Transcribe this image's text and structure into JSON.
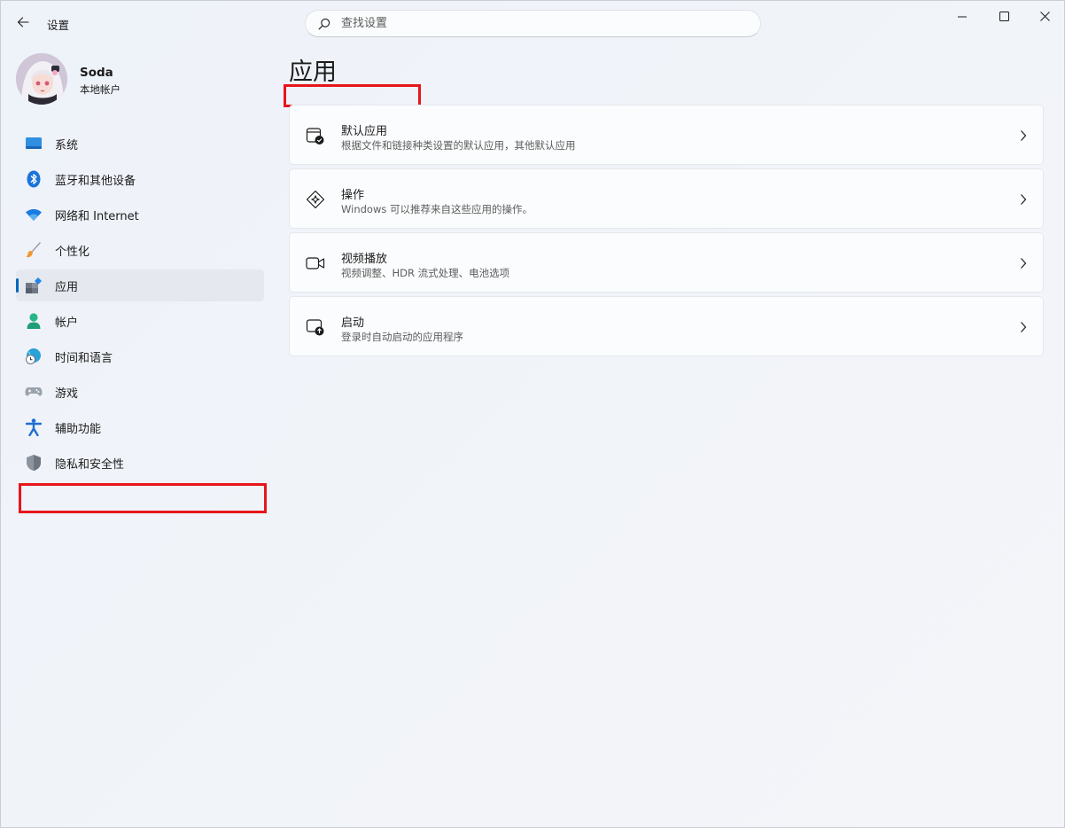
{
  "window": {
    "title": "设置",
    "controls": {
      "minimize": "minimize-icon",
      "maximize": "maximize-icon",
      "close": "close-icon"
    }
  },
  "search": {
    "placeholder": "查找设置",
    "value": ""
  },
  "user": {
    "name": "Soda",
    "account_type": "本地帐户"
  },
  "sidebar": {
    "items": [
      {
        "label": "系统",
        "icon": "monitor-icon",
        "selected": false
      },
      {
        "label": "蓝牙和其他设备",
        "icon": "bluetooth-icon",
        "selected": false
      },
      {
        "label": "网络和 Internet",
        "icon": "wifi-icon",
        "selected": false
      },
      {
        "label": "个性化",
        "icon": "brush-icon",
        "selected": false
      },
      {
        "label": "应用",
        "icon": "apps-icon",
        "selected": true
      },
      {
        "label": "帐户",
        "icon": "person-icon",
        "selected": false
      },
      {
        "label": "时间和语言",
        "icon": "globe-clock-icon",
        "selected": false
      },
      {
        "label": "游戏",
        "icon": "gamepad-icon",
        "selected": false
      },
      {
        "label": "辅助功能",
        "icon": "accessibility-icon",
        "selected": false
      },
      {
        "label": "隐私和安全性",
        "icon": "shield-icon",
        "selected": false
      }
    ]
  },
  "main": {
    "title": "应用",
    "cards": [
      {
        "title": "默认应用",
        "description": "根据文件和链接种类设置的默认应用，其他默认应用",
        "icon": "default-apps-icon"
      },
      {
        "title": "操作",
        "description": "Windows 可以推荐来自这些应用的操作。",
        "icon": "actions-sparkle-icon"
      },
      {
        "title": "视频播放",
        "description": "视频调整、HDR 流式处理、电池选项",
        "icon": "video-camera-icon"
      },
      {
        "title": "启动",
        "description": "登录时自动启动的应用程序",
        "icon": "startup-icon"
      }
    ]
  },
  "colors": {
    "accent": "#0067c0",
    "highlight_box": "#e8151c",
    "background": "#eef2f9",
    "card": "#fbfcfd"
  }
}
